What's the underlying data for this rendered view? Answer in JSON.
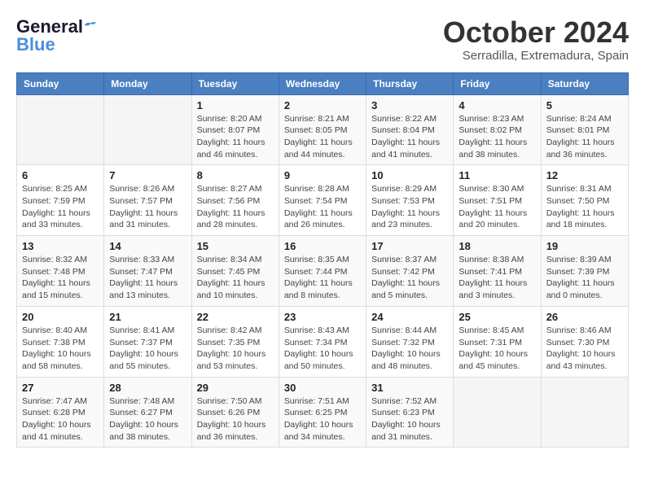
{
  "logo": {
    "line1": "General",
    "line2": "Blue"
  },
  "title": "October 2024",
  "subtitle": "Serradilla, Extremadura, Spain",
  "headers": [
    "Sunday",
    "Monday",
    "Tuesday",
    "Wednesday",
    "Thursday",
    "Friday",
    "Saturday"
  ],
  "weeks": [
    [
      {
        "day": "",
        "info": ""
      },
      {
        "day": "",
        "info": ""
      },
      {
        "day": "1",
        "info": "Sunrise: 8:20 AM\nSunset: 8:07 PM\nDaylight: 11 hours and 46 minutes."
      },
      {
        "day": "2",
        "info": "Sunrise: 8:21 AM\nSunset: 8:05 PM\nDaylight: 11 hours and 44 minutes."
      },
      {
        "day": "3",
        "info": "Sunrise: 8:22 AM\nSunset: 8:04 PM\nDaylight: 11 hours and 41 minutes."
      },
      {
        "day": "4",
        "info": "Sunrise: 8:23 AM\nSunset: 8:02 PM\nDaylight: 11 hours and 38 minutes."
      },
      {
        "day": "5",
        "info": "Sunrise: 8:24 AM\nSunset: 8:01 PM\nDaylight: 11 hours and 36 minutes."
      }
    ],
    [
      {
        "day": "6",
        "info": "Sunrise: 8:25 AM\nSunset: 7:59 PM\nDaylight: 11 hours and 33 minutes."
      },
      {
        "day": "7",
        "info": "Sunrise: 8:26 AM\nSunset: 7:57 PM\nDaylight: 11 hours and 31 minutes."
      },
      {
        "day": "8",
        "info": "Sunrise: 8:27 AM\nSunset: 7:56 PM\nDaylight: 11 hours and 28 minutes."
      },
      {
        "day": "9",
        "info": "Sunrise: 8:28 AM\nSunset: 7:54 PM\nDaylight: 11 hours and 26 minutes."
      },
      {
        "day": "10",
        "info": "Sunrise: 8:29 AM\nSunset: 7:53 PM\nDaylight: 11 hours and 23 minutes."
      },
      {
        "day": "11",
        "info": "Sunrise: 8:30 AM\nSunset: 7:51 PM\nDaylight: 11 hours and 20 minutes."
      },
      {
        "day": "12",
        "info": "Sunrise: 8:31 AM\nSunset: 7:50 PM\nDaylight: 11 hours and 18 minutes."
      }
    ],
    [
      {
        "day": "13",
        "info": "Sunrise: 8:32 AM\nSunset: 7:48 PM\nDaylight: 11 hours and 15 minutes."
      },
      {
        "day": "14",
        "info": "Sunrise: 8:33 AM\nSunset: 7:47 PM\nDaylight: 11 hours and 13 minutes."
      },
      {
        "day": "15",
        "info": "Sunrise: 8:34 AM\nSunset: 7:45 PM\nDaylight: 11 hours and 10 minutes."
      },
      {
        "day": "16",
        "info": "Sunrise: 8:35 AM\nSunset: 7:44 PM\nDaylight: 11 hours and 8 minutes."
      },
      {
        "day": "17",
        "info": "Sunrise: 8:37 AM\nSunset: 7:42 PM\nDaylight: 11 hours and 5 minutes."
      },
      {
        "day": "18",
        "info": "Sunrise: 8:38 AM\nSunset: 7:41 PM\nDaylight: 11 hours and 3 minutes."
      },
      {
        "day": "19",
        "info": "Sunrise: 8:39 AM\nSunset: 7:39 PM\nDaylight: 11 hours and 0 minutes."
      }
    ],
    [
      {
        "day": "20",
        "info": "Sunrise: 8:40 AM\nSunset: 7:38 PM\nDaylight: 10 hours and 58 minutes."
      },
      {
        "day": "21",
        "info": "Sunrise: 8:41 AM\nSunset: 7:37 PM\nDaylight: 10 hours and 55 minutes."
      },
      {
        "day": "22",
        "info": "Sunrise: 8:42 AM\nSunset: 7:35 PM\nDaylight: 10 hours and 53 minutes."
      },
      {
        "day": "23",
        "info": "Sunrise: 8:43 AM\nSunset: 7:34 PM\nDaylight: 10 hours and 50 minutes."
      },
      {
        "day": "24",
        "info": "Sunrise: 8:44 AM\nSunset: 7:32 PM\nDaylight: 10 hours and 48 minutes."
      },
      {
        "day": "25",
        "info": "Sunrise: 8:45 AM\nSunset: 7:31 PM\nDaylight: 10 hours and 45 minutes."
      },
      {
        "day": "26",
        "info": "Sunrise: 8:46 AM\nSunset: 7:30 PM\nDaylight: 10 hours and 43 minutes."
      }
    ],
    [
      {
        "day": "27",
        "info": "Sunrise: 7:47 AM\nSunset: 6:28 PM\nDaylight: 10 hours and 41 minutes."
      },
      {
        "day": "28",
        "info": "Sunrise: 7:48 AM\nSunset: 6:27 PM\nDaylight: 10 hours and 38 minutes."
      },
      {
        "day": "29",
        "info": "Sunrise: 7:50 AM\nSunset: 6:26 PM\nDaylight: 10 hours and 36 minutes."
      },
      {
        "day": "30",
        "info": "Sunrise: 7:51 AM\nSunset: 6:25 PM\nDaylight: 10 hours and 34 minutes."
      },
      {
        "day": "31",
        "info": "Sunrise: 7:52 AM\nSunset: 6:23 PM\nDaylight: 10 hours and 31 minutes."
      },
      {
        "day": "",
        "info": ""
      },
      {
        "day": "",
        "info": ""
      }
    ]
  ]
}
